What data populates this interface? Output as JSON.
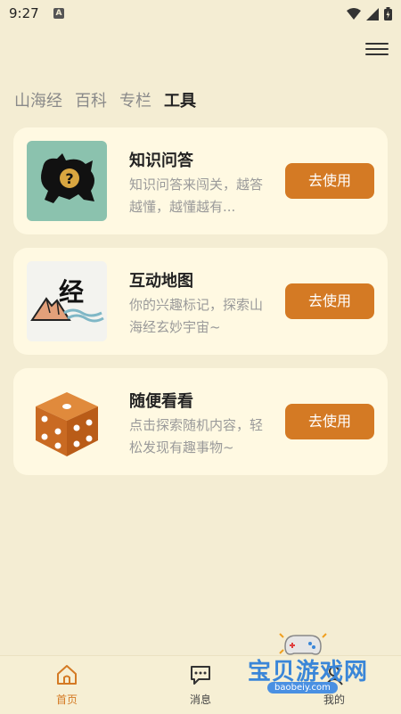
{
  "status": {
    "time": "9:27",
    "a_badge": "A"
  },
  "tabs": [
    {
      "label": "山海经",
      "active": false
    },
    {
      "label": "百科",
      "active": false
    },
    {
      "label": "专栏",
      "active": false
    },
    {
      "label": "工具",
      "active": true
    }
  ],
  "cards": [
    {
      "title": "知识问答",
      "desc": "知识问答来闯关，越答越懂，越懂越有...",
      "button": "去使用",
      "icon": "beast-question-icon",
      "thumb_bg": "#8BC2AE"
    },
    {
      "title": "互动地图",
      "desc": "你的兴趣标记，探索山海经玄妙宇宙~",
      "button": "去使用",
      "icon": "mountain-map-icon",
      "thumb_label": "经"
    },
    {
      "title": "随便看看",
      "desc": "点击探索随机内容，轻松发现有趣事物~",
      "button": "去使用",
      "icon": "dice-icon"
    }
  ],
  "bottom_nav": [
    {
      "label": "首页",
      "icon": "home-icon",
      "active": true
    },
    {
      "label": "消息",
      "icon": "message-icon",
      "active": false
    },
    {
      "label": "我的",
      "icon": "profile-icon",
      "active": false
    }
  ],
  "watermark": {
    "text": "宝贝游戏网",
    "url": "baobeiy.com"
  },
  "colors": {
    "background": "#F4EDD3",
    "card": "#FFF9E2",
    "accent": "#D47A24"
  }
}
